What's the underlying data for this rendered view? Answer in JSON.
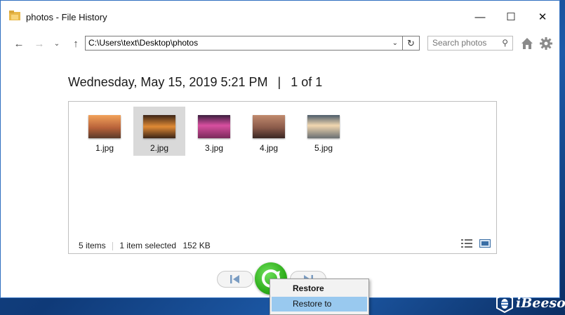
{
  "window": {
    "title": "photos - File History",
    "controls": {
      "minimize": "—",
      "maximize": "☐",
      "close": "✕"
    }
  },
  "nav": {
    "address": "C:\\Users\\text\\Desktop\\photos",
    "search_placeholder": "Search photos"
  },
  "header": {
    "date": "Wednesday, May 15, 2019 5:21 PM",
    "separator": "|",
    "position": "1 of 1"
  },
  "files": [
    {
      "name": "1.jpg",
      "selected": false,
      "colors": [
        "#f2a25a",
        "#5b3a2a"
      ]
    },
    {
      "name": "2.jpg",
      "selected": true,
      "colors": [
        "#e08a35",
        "#3b2416"
      ]
    },
    {
      "name": "3.jpg",
      "selected": false,
      "colors": [
        "#d84fa0",
        "#3b1e3e"
      ]
    },
    {
      "name": "4.jpg",
      "selected": false,
      "colors": [
        "#c08a6e",
        "#3a2622"
      ]
    },
    {
      "name": "5.jpg",
      "selected": false,
      "colors": [
        "#f1d7b0",
        "#4b5b6a"
      ]
    }
  ],
  "status": {
    "count": "5 items",
    "selection": "1 item selected",
    "size": "152 KB"
  },
  "context_menu": {
    "items": [
      "Restore",
      "Restore to"
    ]
  },
  "watermark": {
    "text": "iBeesoft"
  },
  "colors": {
    "accent": "#2fae1c",
    "highlight": "#99c9ef",
    "border": "#2f6fc0"
  }
}
